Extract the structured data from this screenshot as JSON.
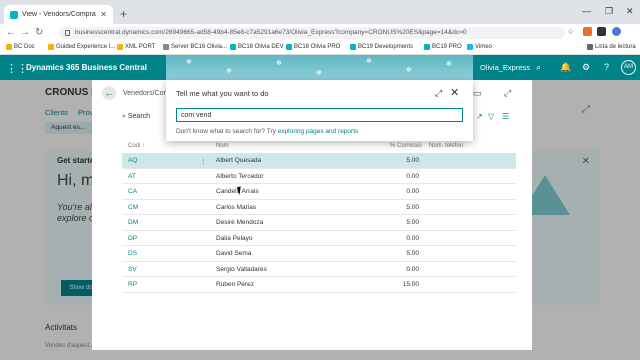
{
  "browser": {
    "tab_title": "View - Vendors/Compradors - Di",
    "url": "businesscentral.dynamics.com/26949665-ad58-49b4-85e8-c7a5291a6e73/Olivia_Express?company=CRONUS%20ES&page=14&dc=0",
    "bookmarks": [
      "BC Doc",
      "Guided Experience I...",
      "XML PORT",
      "Server BC16 Olivia...",
      "BC16 Olivia DEV",
      "BC16 Olivia PRO",
      "BC19 Developments",
      "BC19 PRO",
      "Vimeo",
      "Lista de lectura"
    ]
  },
  "app": {
    "name": "Dynamics 365 Business Central",
    "environment": "Olivia_Express",
    "user_initials": "AM"
  },
  "background": {
    "company": "CRONUS ES",
    "links": [
      "Clients",
      "Prov"
    ],
    "info": "Aquest es...",
    "card_title": "Get starte",
    "greeting": "Hi, m",
    "body": "You're all\nexplore ou",
    "button": "Show do",
    "activities": "Activitats",
    "sub": "Vendes d'aquest..."
  },
  "panel": {
    "breadcrumb": "Venedors/Com",
    "search_label": "Search",
    "columns": [
      "Codi ↑",
      "Nom",
      "% Comissió",
      "Núm. telèfon"
    ],
    "rows": [
      {
        "code": "AQ",
        "name": "Albert Quesada",
        "commission": "5.00"
      },
      {
        "code": "AT",
        "name": "Alberto Tercedor",
        "commission": "0.00"
      },
      {
        "code": "CA",
        "name": "Candela Arrais",
        "commission": "0.00"
      },
      {
        "code": "CM",
        "name": "Carlos Matías",
        "commission": "5.00"
      },
      {
        "code": "DM",
        "name": "Desiré Mendoza",
        "commission": "5.00"
      },
      {
        "code": "DP",
        "name": "Dalia Pelayo",
        "commission": "0.00"
      },
      {
        "code": "DS",
        "name": "David Sema",
        "commission": "5.00"
      },
      {
        "code": "SV",
        "name": "Sergio Valladares",
        "commission": "0.00"
      },
      {
        "code": "RP",
        "name": "Ruben Perez",
        "commission": "15.00"
      }
    ]
  },
  "dialog": {
    "heading": "Tell me what you want to do",
    "query": "com vend",
    "hint_prefix": "Don't know what to search for? Try ",
    "hint_link": "exploring pages and reports"
  }
}
